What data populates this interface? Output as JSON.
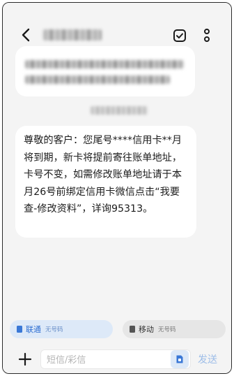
{
  "message": {
    "body": "尊敬的客户：您尾号****信用卡**月将到期，新卡将提前寄往账单地址，卡号不变，如需修改账单地址请于本月26号前绑定信用卡微信点击“我要查-修改资料”，详询95313。"
  },
  "sims": [
    {
      "name": "联通",
      "number": "无号码",
      "selected": true
    },
    {
      "name": "移动",
      "number": "无号码",
      "selected": false
    }
  ],
  "compose": {
    "placeholder": "短信/彩信",
    "send_label": "发送"
  },
  "icons": {
    "back": "back-arrow-icon",
    "verify": "verified-check-icon",
    "more": "more-vertical-icon",
    "plus": "plus-icon",
    "sim": "sim-card-icon"
  },
  "colors": {
    "accent": "#2f6fd2",
    "send_disabled": "#9dbde8",
    "background": "#f4f4f4",
    "bubble": "#ffffff"
  }
}
